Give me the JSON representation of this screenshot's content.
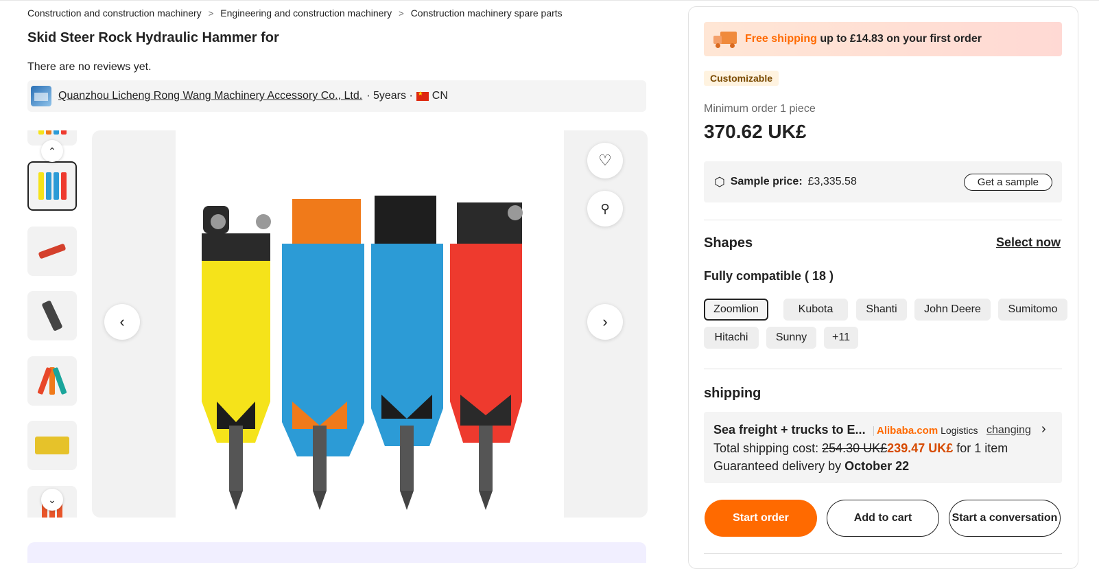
{
  "breadcrumb": [
    "Construction and construction machinery",
    "Engineering and construction machinery",
    "Construction machinery spare parts"
  ],
  "product": {
    "title": "Skid Steer Rock Hydraulic Hammer for",
    "reviews_text": "There are no reviews yet."
  },
  "supplier": {
    "name": "Quanzhou Licheng Rong Wang Machinery Accessory Co., Ltd.",
    "years": "· 5years ·",
    "country": "CN"
  },
  "gallery": {
    "thumb_count": 7,
    "selected_index": 1
  },
  "colors": {
    "accent": "#ff6a00",
    "hammer_yellow": "#f5e31a",
    "hammer_blue": "#2c9bd6",
    "hammer_orange": "#f07a1a",
    "hammer_red": "#ee3a2e"
  },
  "panel": {
    "shipping_banner": {
      "highlight": "Free shipping",
      "rest": " up to £14.83 on your first order"
    },
    "customizable": "Customizable",
    "min_order": "Minimum order 1 piece",
    "price": "370.62 UK£",
    "sample": {
      "label": "Sample price:",
      "value": "£3,335.58",
      "button": "Get a sample"
    },
    "shapes": {
      "heading": "Shapes",
      "select_now": "Select now",
      "compat": "Fully compatible ( 18 )",
      "chips": [
        "Zoomlion",
        "Kubota",
        "Shanti",
        "John Deere",
        "Sumitomo",
        "Hitachi",
        "Sunny",
        "+11"
      ]
    },
    "shipping": {
      "heading": "shipping",
      "method": "Sea freight + trucks to E...",
      "logo_brand": "Alibaba.com",
      "logo_suffix": " Logistics",
      "change": "changing",
      "cost_label": "Total shipping cost: ",
      "old_cost": "254.30 UK£",
      "new_cost": "239.47 UK£",
      "cost_suffix": " for 1 item",
      "delivery_label": "Guaranteed delivery by ",
      "delivery_date": "October 22"
    },
    "buttons": {
      "order": "Start order",
      "cart": "Add to cart",
      "conversation": "Start a conversation"
    }
  }
}
